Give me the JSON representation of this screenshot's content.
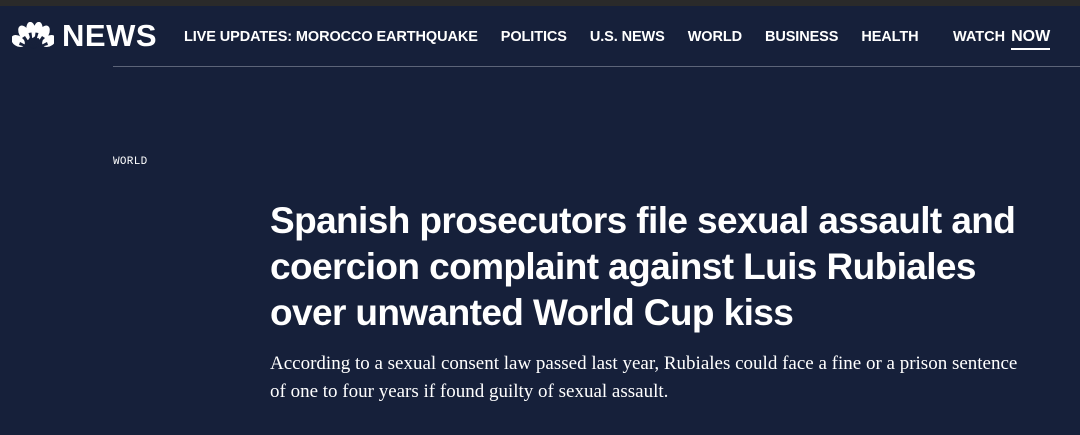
{
  "header": {
    "logo_text": "NEWS",
    "nav": [
      "LIVE UPDATES: MOROCCO EARTHQUAKE",
      "POLITICS",
      "U.S. NEWS",
      "WORLD",
      "BUSINESS",
      "HEALTH"
    ],
    "watch_label": "WATCH",
    "watch_now": "NOW"
  },
  "article": {
    "section": "WORLD",
    "headline": "Spanish prosecutors file sexual assault and coercion complaint against Luis Rubiales over unwanted World Cup kiss",
    "dek": "According to a sexual consent law passed last year, Rubiales could face a fine or a prison sentence of one to four years if found guilty of sexual assault."
  },
  "colors": {
    "background": "#16203a",
    "text": "#ffffff",
    "peacock": [
      "#fcb711",
      "#f37021",
      "#cc004c",
      "#6460aa",
      "#0089d0",
      "#0db14b"
    ]
  },
  "icons": {
    "logo": "nbc-peacock-icon"
  }
}
